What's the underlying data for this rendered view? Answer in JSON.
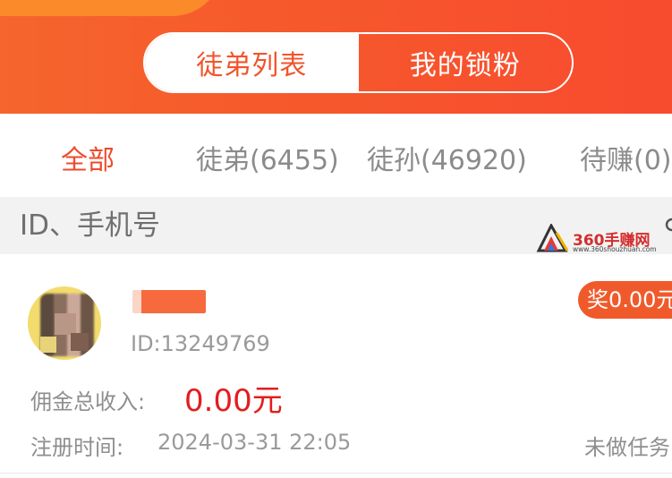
{
  "header": {
    "segment": [
      {
        "label": "徒弟列表",
        "active": true
      },
      {
        "label": "我的锁粉",
        "active": false
      }
    ],
    "accent_color": "#f6582c"
  },
  "filter_tabs": [
    {
      "label": "全部",
      "active": true
    },
    {
      "label": "徒弟(6455)",
      "active": false
    },
    {
      "label": "徒孙(46920)",
      "active": false
    },
    {
      "label": "待赚(0)",
      "active": false
    }
  ],
  "search": {
    "placeholder": "ID、手机号",
    "icon": "search-icon"
  },
  "watermark": {
    "text": "360手赚网",
    "url": "www.360shouzhuan.com"
  },
  "list": [
    {
      "avatar": "avatar-mosaic",
      "id_text": "ID:13249769",
      "reward": "奖0.00元",
      "commission_label": "佣金总收入:",
      "commission_value": "0.00元",
      "register_label": "注册时间:",
      "register_time": "2024-03-31 22:05",
      "task_status": "未做任务"
    }
  ]
}
